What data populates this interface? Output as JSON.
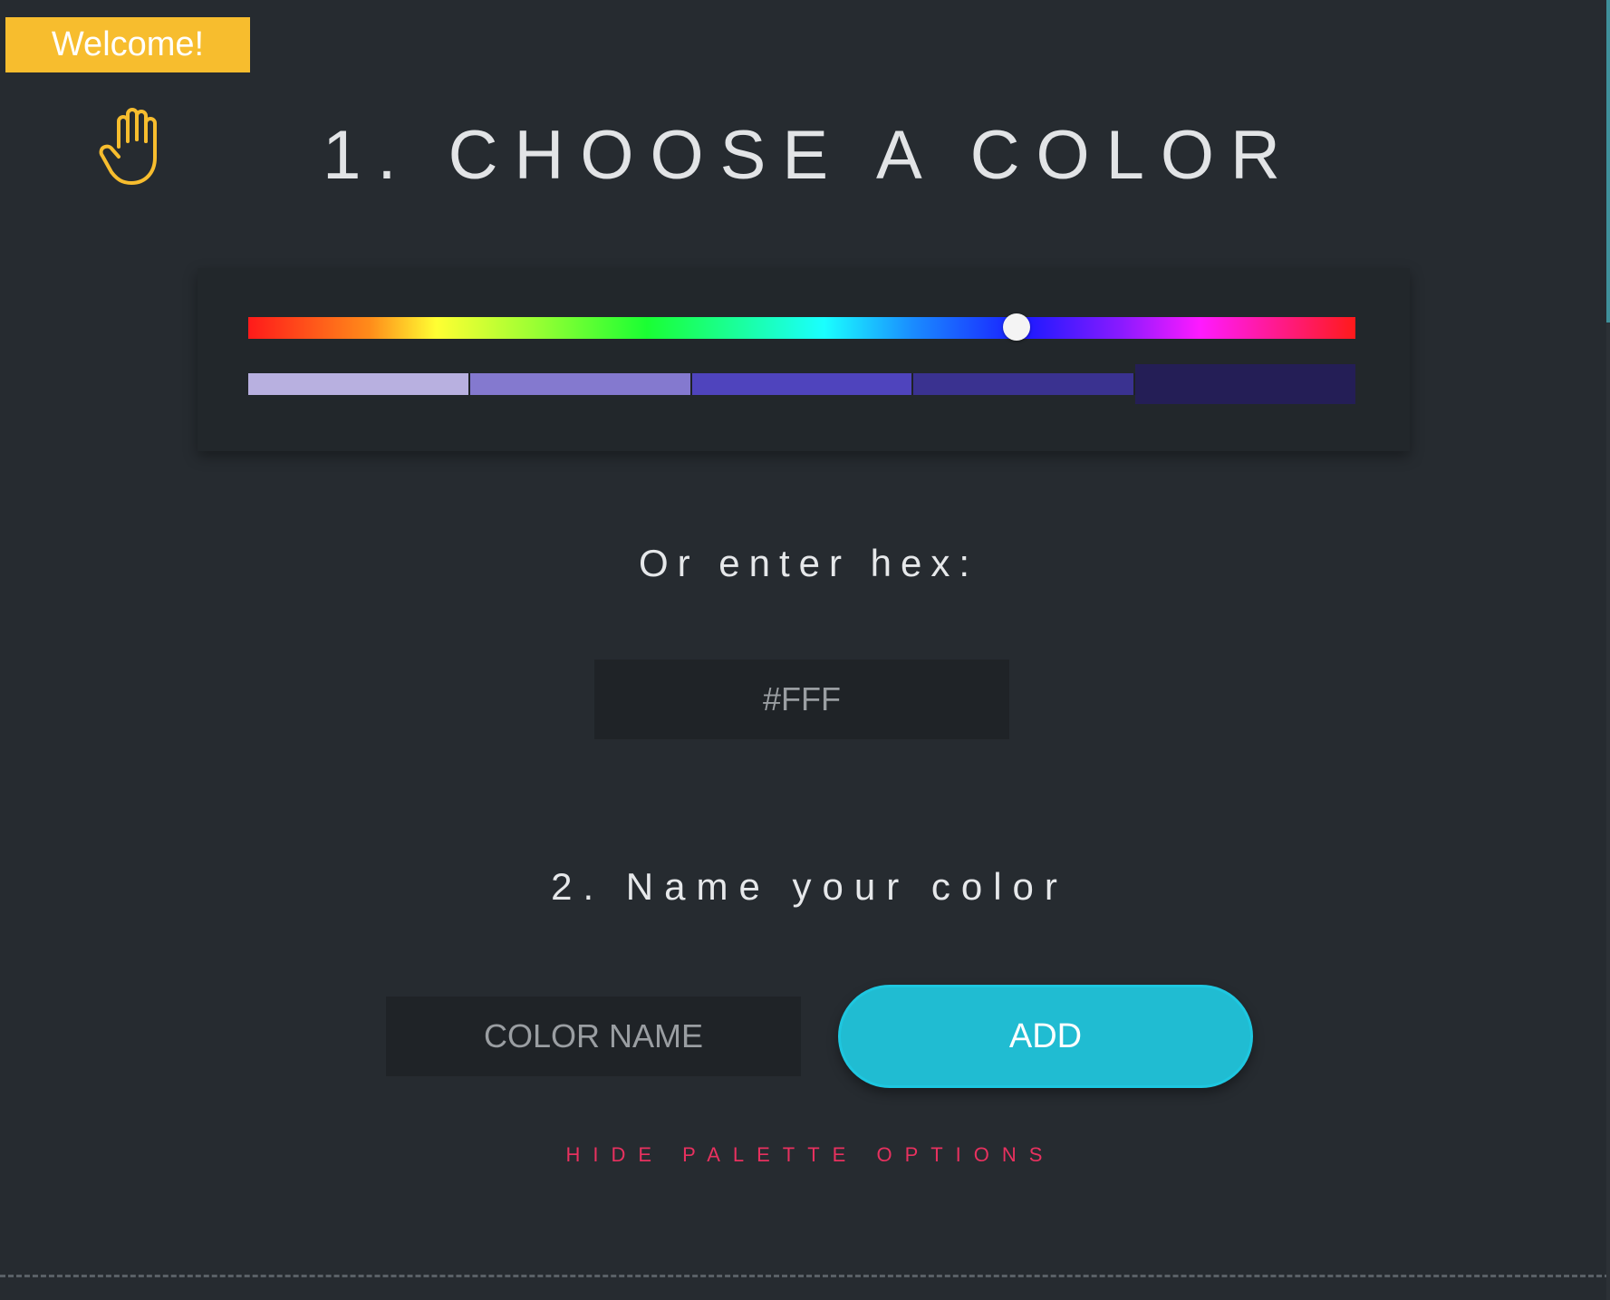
{
  "welcome": {
    "label": "Welcome!"
  },
  "icons": {
    "hand": "raised-hand-icon"
  },
  "step1": {
    "title": "1. CHOOSE A COLOR"
  },
  "picker": {
    "hue_value": 0.694,
    "shades": [
      {
        "color": "#b8b0e0"
      },
      {
        "color": "#8479cf"
      },
      {
        "color": "#4f44bd"
      },
      {
        "color": "#3a3290"
      },
      {
        "color": "#241e56",
        "selected": true
      }
    ]
  },
  "hex": {
    "label": "Or enter hex:",
    "placeholder": "#FFF"
  },
  "step2": {
    "title": "2. Name your color"
  },
  "name_field": {
    "placeholder": "COLOR NAME"
  },
  "add_button": {
    "label": "ADD"
  },
  "toggle_link": {
    "label": "HIDE PALETTE OPTIONS"
  },
  "colors": {
    "background": "#262b30",
    "accent": "#20bcd2",
    "welcome": "#f7bd2e",
    "link": "#e8315f"
  }
}
